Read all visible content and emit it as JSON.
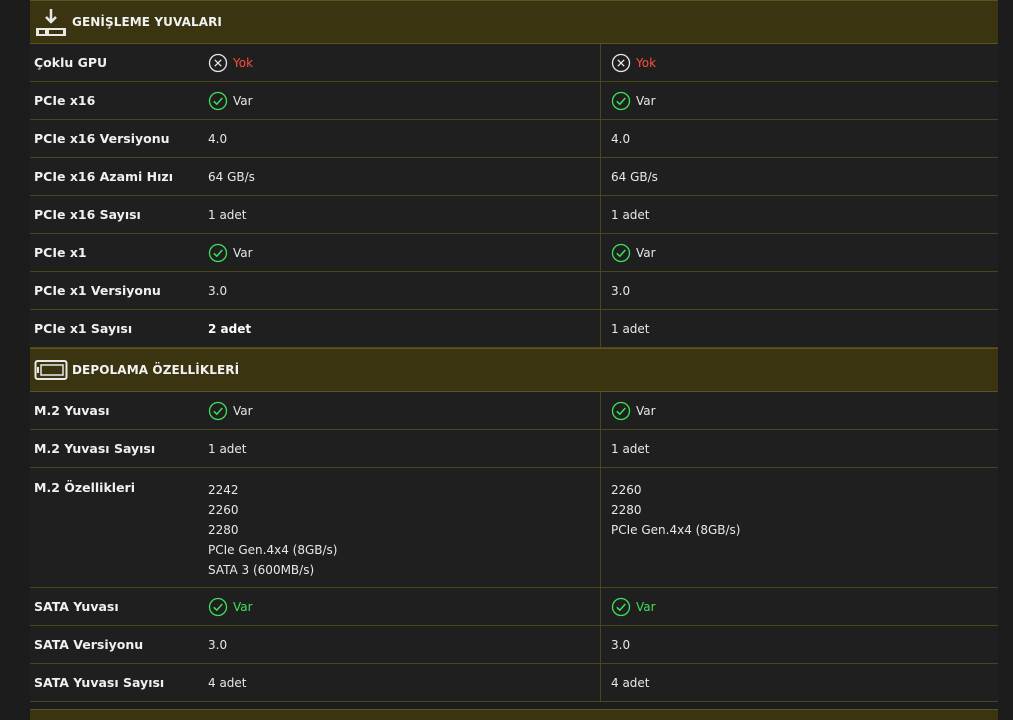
{
  "sections": {
    "expansion": {
      "title": "GENİŞLEME YUVALARI",
      "icon": "expansion-slot-icon",
      "rows": [
        {
          "label": "Çoklu GPU",
          "a": "Yok",
          "b": "Yok"
        },
        {
          "label": "PCIe x16",
          "a": "Var",
          "b": "Var"
        },
        {
          "label": "PCIe x16 Versiyonu",
          "a": "4.0",
          "b": "4.0"
        },
        {
          "label": "PCIe x16 Azami Hızı",
          "a": "64 GB/s",
          "b": "64 GB/s"
        },
        {
          "label": "PCIe x16 Sayısı",
          "a": "1 adet",
          "b": "1 adet"
        },
        {
          "label": "PCIe x1",
          "a": "Var",
          "b": "Var"
        },
        {
          "label": "PCIe x1 Versiyonu",
          "a": "3.0",
          "b": "3.0"
        },
        {
          "label": "PCIe x1 Sayısı",
          "a": "2 adet",
          "b": "1 adet"
        }
      ]
    },
    "storage": {
      "title": "DEPOLAMA ÖZELLİKLERİ",
      "icon": "storage-drive-icon",
      "rows": [
        {
          "label": "M.2 Yuvası",
          "a": "Var",
          "b": "Var"
        },
        {
          "label": "M.2 Yuvası Sayısı",
          "a": "1 adet",
          "b": "1 adet"
        },
        {
          "label": "M.2 Özellikleri",
          "a": [
            "2242",
            "2260",
            "2280",
            "PCIe Gen.4x4 (8GB/s)",
            "SATA 3 (600MB/s)"
          ],
          "b": [
            "2260",
            "2280",
            "PCIe Gen.4x4 (8GB/s)"
          ]
        },
        {
          "label": "SATA Yuvası",
          "a": "Var",
          "b": "Var"
        },
        {
          "label": "SATA Versiyonu",
          "a": "3.0",
          "b": "3.0"
        },
        {
          "label": "SATA Yuvası Sayısı",
          "a": "4 adet",
          "b": "4 adet"
        }
      ]
    }
  },
  "colors": {
    "accent_header": "#3a3510",
    "check_green": "#3ee05a",
    "cross_red": "#ff4d3a"
  }
}
